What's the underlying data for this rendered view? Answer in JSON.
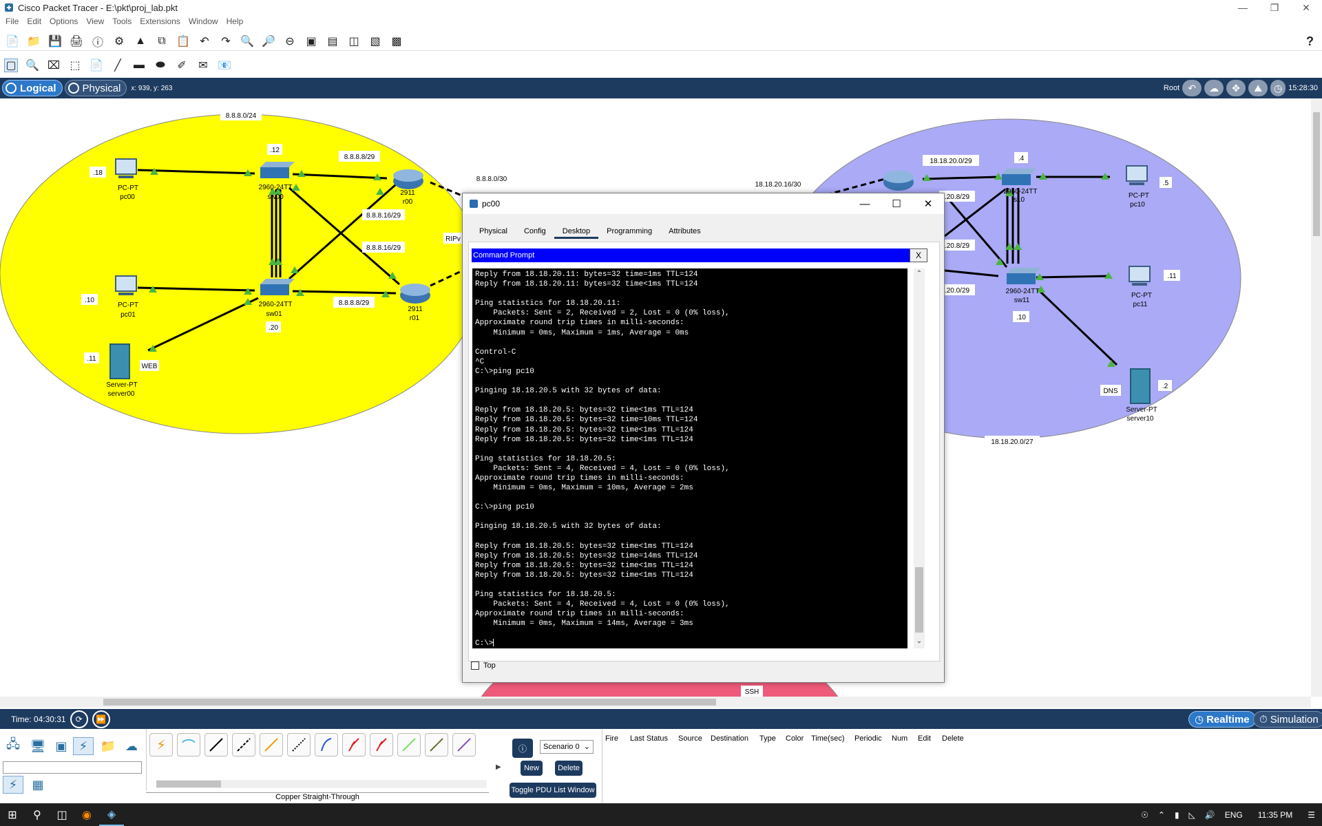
{
  "window": {
    "title": "Cisco Packet Tracer - E:\\pkt\\proj_lab.pkt"
  },
  "menu": [
    "File",
    "Edit",
    "Options",
    "View",
    "Tools",
    "Extensions",
    "Window",
    "Help"
  ],
  "modebar": {
    "logical_label": "Logical",
    "physical_label": "Physical",
    "coords": "x: 939, y: 263",
    "root_label": "Root",
    "clock": "15:28:30"
  },
  "topology": {
    "left": {
      "network_label": "8.8.8.0/24",
      "devices": [
        {
          "id": "pc00",
          "type": "PC-PT",
          "name": "pc00",
          "ip": ".18"
        },
        {
          "id": "sw00",
          "type": "2960-24TT",
          "name": "sw00",
          "ip": ".12"
        },
        {
          "id": "r00",
          "type": "2911",
          "name": "r00"
        },
        {
          "id": "pc01",
          "type": "PC-PT",
          "name": "pc01",
          "ip": ".10"
        },
        {
          "id": "sw01",
          "type": "2960-24TT",
          "name": "sw01",
          "ip": ".20"
        },
        {
          "id": "r01",
          "type": "2911",
          "name": "r01"
        },
        {
          "id": "server00",
          "type": "Server-PT",
          "name": "server00",
          "ip": ".11",
          "note": "WEB"
        }
      ],
      "labels": [
        "8.8.8.8/29",
        "8.8.8.16/29",
        "8.8.8.16/29",
        "8.8.8.8/29",
        "8.8.8.0/30",
        "RIPv"
      ]
    },
    "right": {
      "network_label": "18.18.20.0/27",
      "devices": [
        {
          "id": "sw10",
          "type": "2960-24TT",
          "name": "s10",
          "ip": ".4"
        },
        {
          "id": "pc10",
          "type": "PC-PT",
          "name": "pc10",
          "ip": ".5"
        },
        {
          "id": "sw11",
          "type": "2960-24TT",
          "name": "sw11",
          "ip": ".10"
        },
        {
          "id": "pc11",
          "type": "PC-PT",
          "name": "pc11",
          "ip": ".11"
        },
        {
          "id": "server10",
          "type": "Server-PT",
          "name": "server10",
          "ip": ".2",
          "note": "DNS"
        }
      ],
      "labels": [
        "18.18.20.0/29",
        "18.18.20.16/30",
        ".20.8/29",
        ".20.8/29",
        ".20.0/29"
      ]
    },
    "bottom_label": "SSH",
    "colors": {
      "left_cloud": "#ffff00",
      "right_cloud": "#aaaaf6",
      "bottom_cloud": "#ee5a7a",
      "link_port": "#4bb543"
    }
  },
  "dialog": {
    "title": "pc00",
    "tabs": [
      "Physical",
      "Config",
      "Desktop",
      "Programming",
      "Attributes"
    ],
    "active_tab": "Desktop",
    "panel_title": "Command Prompt",
    "close_label": "X",
    "top_checkbox_label": "Top",
    "terminal_lines": [
      "Reply from 18.18.20.11: bytes=32 time=1ms TTL=124",
      "Reply from 18.18.20.11: bytes=32 time<1ms TTL=124",
      "",
      "Ping statistics for 18.18.20.11:",
      "    Packets: Sent = 2, Received = 2, Lost = 0 (0% loss),",
      "Approximate round trip times in milli-seconds:",
      "    Minimum = 0ms, Maximum = 1ms, Average = 0ms",
      "",
      "Control-C",
      "^C",
      "C:\\>ping pc10",
      "",
      "Pinging 18.18.20.5 with 32 bytes of data:",
      "",
      "Reply from 18.18.20.5: bytes=32 time<1ms TTL=124",
      "Reply from 18.18.20.5: bytes=32 time=10ms TTL=124",
      "Reply from 18.18.20.5: bytes=32 time<1ms TTL=124",
      "Reply from 18.18.20.5: bytes=32 time<1ms TTL=124",
      "",
      "Ping statistics for 18.18.20.5:",
      "    Packets: Sent = 4, Received = 4, Lost = 0 (0% loss),",
      "Approximate round trip times in milli-seconds:",
      "    Minimum = 0ms, Maximum = 10ms, Average = 2ms",
      "",
      "C:\\>ping pc10",
      "",
      "Pinging 18.18.20.5 with 32 bytes of data:",
      "",
      "Reply from 18.18.20.5: bytes=32 time<1ms TTL=124",
      "Reply from 18.18.20.5: bytes=32 time=14ms TTL=124",
      "Reply from 18.18.20.5: bytes=32 time<1ms TTL=124",
      "Reply from 18.18.20.5: bytes=32 time<1ms TTL=124",
      "",
      "Ping statistics for 18.18.20.5:",
      "    Packets: Sent = 4, Received = 4, Lost = 0 (0% loss),",
      "Approximate round trip times in milli-seconds:",
      "    Minimum = 0ms, Maximum = 14ms, Average = 3ms",
      "",
      "C:\\>"
    ]
  },
  "simbar": {
    "time": "Time: 04:30:31",
    "realtime_label": "Realtime",
    "simulation_label": "Simulation"
  },
  "bottom": {
    "connection_caption": "Copper Straight-Through",
    "scenario_value": "Scenario 0",
    "new_label": "New",
    "delete_label": "Delete",
    "toggle_label": "Toggle PDU List Window",
    "pdu_headers": [
      "Fire",
      "Last Status",
      "Source",
      "Destination",
      "Type",
      "Color",
      "Time(sec)",
      "Periodic",
      "Num",
      "Edit",
      "Delete"
    ]
  },
  "taskbar": {
    "lang": "ENG",
    "time": "11:35 PM"
  }
}
